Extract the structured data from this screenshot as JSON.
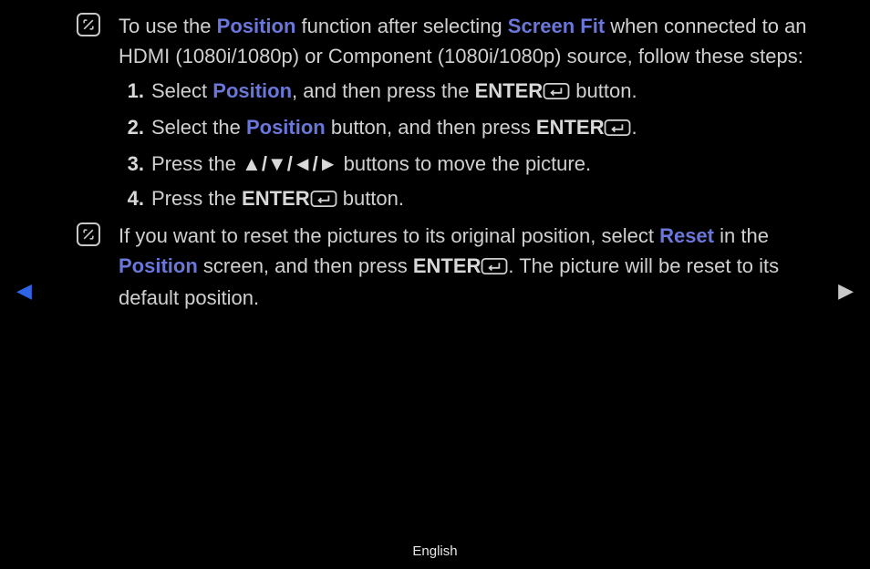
{
  "note1": {
    "t1": "To use the ",
    "position": "Position",
    "t2": " function after selecting ",
    "screenfit": "Screen Fit",
    "t3": " when connected to an HDMI (1080i/1080p) or Component (1080i/1080p) source, follow these steps:"
  },
  "steps": [
    {
      "num": "1.",
      "a": "Select ",
      "pos": "Position",
      "b": ", and then press the ",
      "enter": "ENTER",
      "c": " button."
    },
    {
      "num": "2.",
      "a": "Select the ",
      "pos": "Position",
      "b": " button, and then press ",
      "enter": "ENTER",
      "c": "."
    },
    {
      "num": "3.",
      "a": "Press the ",
      "arrows": "▲/▼/◄/►",
      "b": " buttons to move the picture."
    },
    {
      "num": "4.",
      "a": "Press the ",
      "enter": "ENTER",
      "b": " button."
    }
  ],
  "note2": {
    "t1": "If you want to reset the pictures to its original position, select ",
    "reset": "Reset",
    "t2": " in the ",
    "position": "Position",
    "t3": " screen, and then press ",
    "enter": "ENTER",
    "t4": ". The picture will be reset to its default position."
  },
  "nav": {
    "left": "◀",
    "right": "▶"
  },
  "footer": "English"
}
